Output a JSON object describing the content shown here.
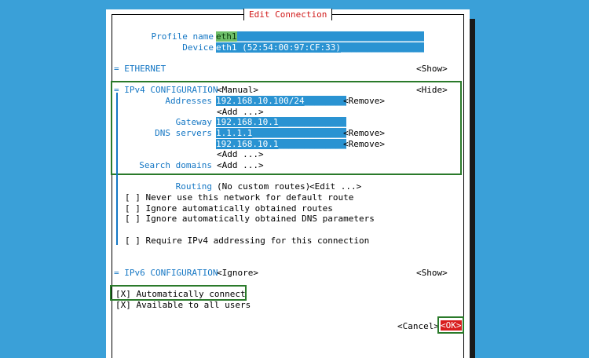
{
  "dialog": {
    "title": "Edit Connection"
  },
  "profile": {
    "name_label": "Profile name",
    "name_value": "eth1",
    "name_fill": "____________________________________",
    "device_label": "Device",
    "device_value": "eth1 (52:54:00:97:CF:33)",
    "device_fill": "________________"
  },
  "ethernet": {
    "header": "= ETHERNET",
    "toggle": "<Show>"
  },
  "ipv4": {
    "header": "= IPv4 CONFIGURATION",
    "method": "<Manual>",
    "toggle": "<Hide>",
    "addresses_label": "Addresses",
    "addresses": [
      {
        "value": "192.168.10.100/24",
        "fill": "________",
        "remove": "<Remove>"
      }
    ],
    "add_address": "<Add ...>",
    "gateway_label": "Gateway",
    "gateway_value": "192.168.10.1",
    "gateway_fill": "_____________",
    "dns_label": "DNS servers",
    "dns": [
      {
        "value": "1.1.1.1",
        "fill": "__________________",
        "remove": "<Remove>"
      },
      {
        "value": "192.168.10.1",
        "fill": "_____________",
        "remove": "<Remove>"
      }
    ],
    "add_dns": "<Add ...>",
    "search_label": "Search domains",
    "add_search": "<Add ...>",
    "routing_label": "Routing",
    "routing_value": "(No custom routes)",
    "routing_edit": "<Edit ...>",
    "checks": [
      {
        "box": "[ ]",
        "label": "Never use this network for default route"
      },
      {
        "box": "[ ]",
        "label": "Ignore automatically obtained routes"
      },
      {
        "box": "[ ]",
        "label": "Ignore automatically obtained DNS parameters"
      }
    ],
    "require": {
      "box": "[ ]",
      "label": "Require IPv4 addressing for this connection"
    }
  },
  "ipv6": {
    "header": "= IPv6 CONFIGURATION",
    "method": "<Ignore>",
    "toggle": "<Show>"
  },
  "options": [
    {
      "box": "[X]",
      "label": "Automatically connect"
    },
    {
      "box": "[X]",
      "label": "Available to all users"
    }
  ],
  "buttons": {
    "cancel": "<Cancel>",
    "ok": "<OK>"
  }
}
